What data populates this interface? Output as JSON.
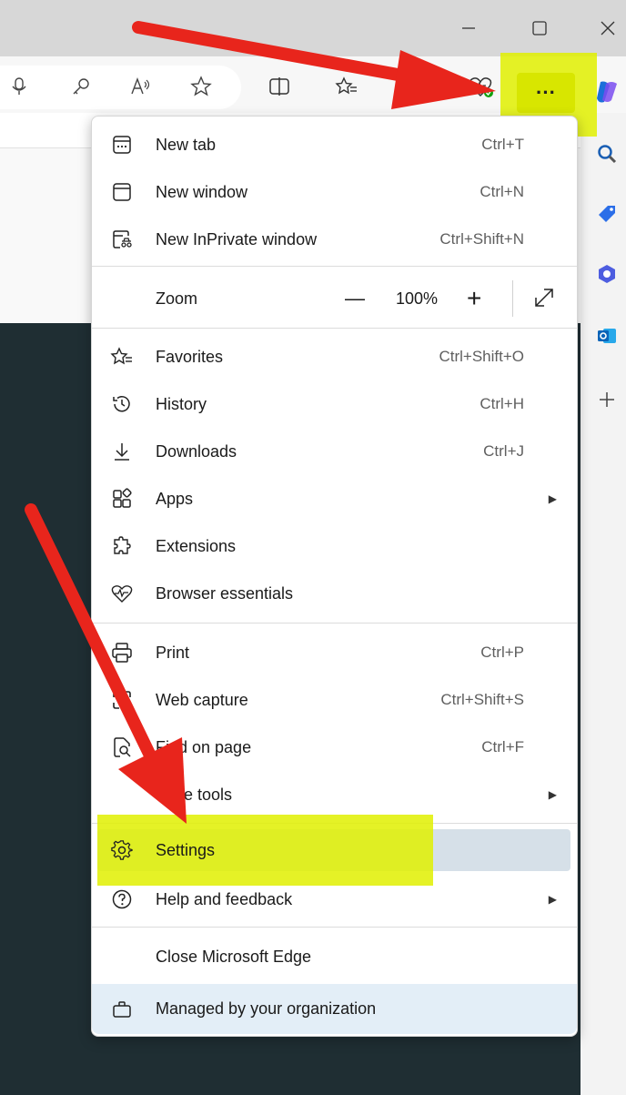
{
  "window": {
    "controls": [
      "minimize-icon",
      "maximize-icon",
      "close-icon"
    ]
  },
  "toolbar": {
    "icons": [
      "microphone-icon",
      "key-icon",
      "read-aloud-icon",
      "favorite-star-icon",
      "split-screen-icon",
      "favorites-list-icon",
      "collections-icon",
      "browser-essentials-heart-icon",
      "more-options-icon"
    ],
    "more_label": "···"
  },
  "sidebar": {
    "icons": [
      "copilot-icon",
      "search-icon",
      "tag-icon",
      "office-icon",
      "outlook-icon",
      "add-icon"
    ]
  },
  "menu": {
    "items": [
      {
        "label": "New tab",
        "shortcut": "Ctrl+T",
        "icon": "new-tab-icon"
      },
      {
        "label": "New window",
        "shortcut": "Ctrl+N",
        "icon": "new-window-icon"
      },
      {
        "label": "New InPrivate window",
        "shortcut": "Ctrl+Shift+N",
        "icon": "inprivate-icon"
      },
      {
        "label": "Favorites",
        "shortcut": "Ctrl+Shift+O",
        "icon": "favorites-icon"
      },
      {
        "label": "History",
        "shortcut": "Ctrl+H",
        "icon": "history-icon"
      },
      {
        "label": "Downloads",
        "shortcut": "Ctrl+J",
        "icon": "download-icon"
      },
      {
        "label": "Apps",
        "shortcut": "",
        "icon": "apps-icon"
      },
      {
        "label": "Extensions",
        "shortcut": "",
        "icon": "extensions-icon"
      },
      {
        "label": "Browser essentials",
        "shortcut": "",
        "icon": "heart-pulse-icon"
      },
      {
        "label": "Print",
        "shortcut": "Ctrl+P",
        "icon": "print-icon"
      },
      {
        "label": "Web capture",
        "shortcut": "Ctrl+Shift+S",
        "icon": "web-capture-icon"
      },
      {
        "label": "Find on page",
        "shortcut": "Ctrl+F",
        "icon": "find-icon"
      },
      {
        "label": "More tools",
        "shortcut": "",
        "icon": ""
      },
      {
        "label": "Settings",
        "shortcut": "",
        "icon": "gear-icon"
      },
      {
        "label": "Help and feedback",
        "shortcut": "",
        "icon": "help-icon"
      },
      {
        "label": "Close Microsoft Edge",
        "shortcut": "",
        "icon": ""
      },
      {
        "label": "Managed by your organization",
        "shortcut": "",
        "icon": "briefcase-icon"
      }
    ],
    "zoom": {
      "label": "Zoom",
      "value": "100%",
      "minus": "—",
      "plus": "+"
    }
  },
  "colors": {
    "highlight": "#e0f000",
    "arrow": "#e8251c",
    "settings_row": "#d6e0e8",
    "managed_row": "#e3eef7"
  }
}
